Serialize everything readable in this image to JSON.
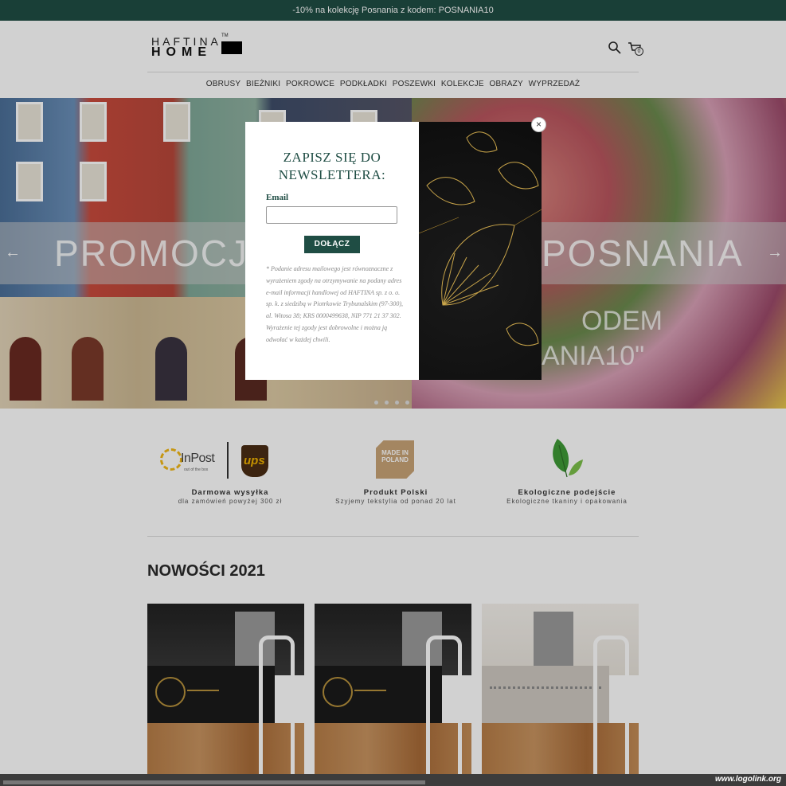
{
  "promo_bar": {
    "text": "-10% na kolekcję Posnania z kodem: POSNANIA10"
  },
  "header": {
    "logo_line1": "HAFTINA",
    "logo_line2": "HOME",
    "logo_tm": "TM",
    "cart_count": "0",
    "icons": [
      "search-icon",
      "cart-icon"
    ]
  },
  "nav": {
    "items": [
      "OBRUSY",
      "BIEŻNIKI",
      "POKROWCE",
      "PODKŁADKI",
      "POSZEWKI",
      "KOLEKCJE",
      "OBRAZY",
      "WYPRZEDAŻ"
    ]
  },
  "hero": {
    "left_text": "PROMOCJA",
    "right_text": "POSNANIA",
    "sub_line1": "ODEM",
    "sub_line2": "ANIA10\"",
    "prev_arrow": "←",
    "next_arrow": "→",
    "slide_count": 4
  },
  "features": [
    {
      "title": "Darmowa wysyłka",
      "subtitle": "dla zamówień powyżej 300 zł",
      "logo_text": "InPost",
      "logo_sub": "out of the box",
      "logo2_text": "ups"
    },
    {
      "title": "Produkt Polski",
      "subtitle": "Szyjemy tekstylia od ponad 20 lat",
      "logo_text": "MADE IN POLAND"
    },
    {
      "title": "Ekologiczne podejście",
      "subtitle": "Ekologiczne tkaniny i opakowania"
    }
  ],
  "section": {
    "title": "NOWOŚCI 2021"
  },
  "modal": {
    "title": "ZAPISZ SIĘ DO NEWSLETTERA:",
    "email_label": "Email",
    "email_value": "",
    "submit_label": "DOŁĄCZ",
    "note": "* Podanie adresu mailowego jest równoznaczne z wyrażeniem zgody na otrzymywanie na podany adres e-mail informacji handlowej od HAFTINA sp. z o. o. sp. k. z siedzibą w Piotrkowie Trybunalskim (97-300), al. Witosa 38; KRS 0000499638, NIP 771 21 37 302. Wyrażenie tej zgody jest dobrowolne i można ją odwołać w każdej chwili.",
    "close_label": "×"
  },
  "watermark": {
    "text": "www.logolink.org"
  },
  "colors": {
    "brand": "#1f4d44",
    "overlay": "rgba(0,0,0,0.18)"
  }
}
